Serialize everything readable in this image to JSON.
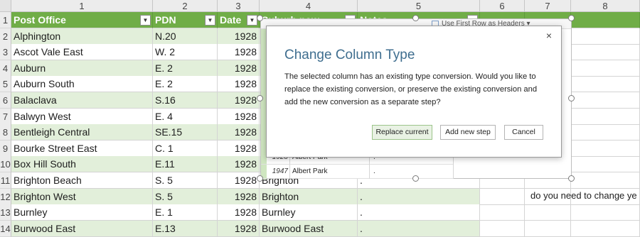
{
  "column_headers": [
    "1",
    "2",
    "3",
    "4",
    "5",
    "6",
    "7",
    "8"
  ],
  "row_numbers": [
    "1",
    "2",
    "3",
    "4",
    "5",
    "6",
    "7",
    "8",
    "9",
    "10",
    "11",
    "12",
    "13",
    "14"
  ],
  "table_headers": [
    "Post Office",
    "PDN",
    "Date",
    "Suburb now",
    "Notes"
  ],
  "rows": [
    {
      "post_office": "Alphington",
      "pdn": "N.20",
      "date": "1928",
      "suburb": "",
      "notes": ""
    },
    {
      "post_office": "Ascot Vale East",
      "pdn": "W. 2",
      "date": "1928",
      "suburb": "",
      "notes": ""
    },
    {
      "post_office": "Auburn",
      "pdn": "E. 2",
      "date": "1928",
      "suburb": "",
      "notes": ""
    },
    {
      "post_office": "Auburn South",
      "pdn": "E. 2",
      "date": "1928",
      "suburb": "",
      "notes": ""
    },
    {
      "post_office": "Balaclava",
      "pdn": "S.16",
      "date": "1928",
      "suburb": "",
      "notes": ""
    },
    {
      "post_office": "Balwyn West",
      "pdn": "E. 4",
      "date": "1928",
      "suburb": "",
      "notes": ""
    },
    {
      "post_office": "Bentleigh Central",
      "pdn": "SE.15",
      "date": "1928",
      "suburb": "",
      "notes": ""
    },
    {
      "post_office": "Bourke Street East",
      "pdn": "C. 1",
      "date": "1928",
      "suburb": "",
      "notes": ""
    },
    {
      "post_office": "Box Hill South",
      "pdn": "E.11",
      "date": "1928",
      "suburb": "",
      "notes": ""
    },
    {
      "post_office": "Brighton Beach",
      "pdn": "S. 5",
      "date": "1928",
      "suburb": "Brighton",
      "notes": "."
    },
    {
      "post_office": "Brighton West",
      "pdn": "S. 5",
      "date": "1928",
      "suburb": "Brighton",
      "notes": "."
    },
    {
      "post_office": "Burnley",
      "pdn": "E. 1",
      "date": "1928",
      "suburb": "Burnley",
      "notes": "."
    },
    {
      "post_office": "Burwood East",
      "pdn": "E.13",
      "date": "1928",
      "suburb": "Burwood East",
      "notes": "."
    }
  ],
  "preview": {
    "first_row_label": "Use First Row as Headers",
    "rows": [
      {
        "year": "1928",
        "suburb": "Albert Park",
        "dot": "."
      },
      {
        "year": "1947",
        "suburb": "Albert Park",
        "dot": "."
      }
    ]
  },
  "dialog": {
    "title": "Change Column Type",
    "close": "×",
    "message": "The selected column has an existing type conversion. Would you like to replace the existing conversion, or preserve the existing conversion and add the new conversion as a separate step?",
    "replace_label": "Replace current",
    "addnew_label": "Add new step",
    "cancel_label": "Cancel"
  },
  "side_note": "do you need to change ye",
  "colors": {
    "table_header": "#70ad47",
    "band": "#e2efda",
    "dialog_title": "#3f6e8f"
  }
}
